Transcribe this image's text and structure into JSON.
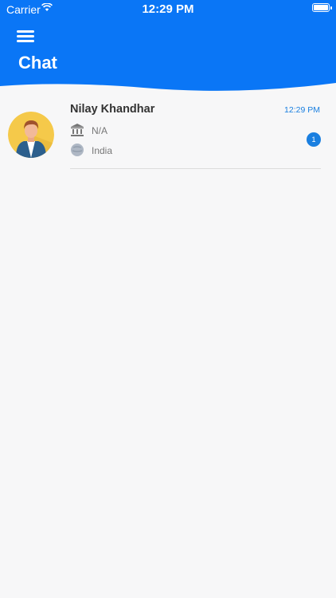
{
  "status_bar": {
    "carrier": "Carrier",
    "time": "12:29 PM"
  },
  "header": {
    "title": "Chat"
  },
  "chats": [
    {
      "name": "Nilay Khandhar",
      "time": "12:29 PM",
      "institution": "N/A",
      "country": "India",
      "unread": "1"
    }
  ],
  "colors": {
    "accent": "#0a76f6",
    "badge": "#1a7fe0"
  },
  "icons": {
    "menu": "hamburger-icon",
    "institution": "bank-icon",
    "country": "globe-icon"
  }
}
